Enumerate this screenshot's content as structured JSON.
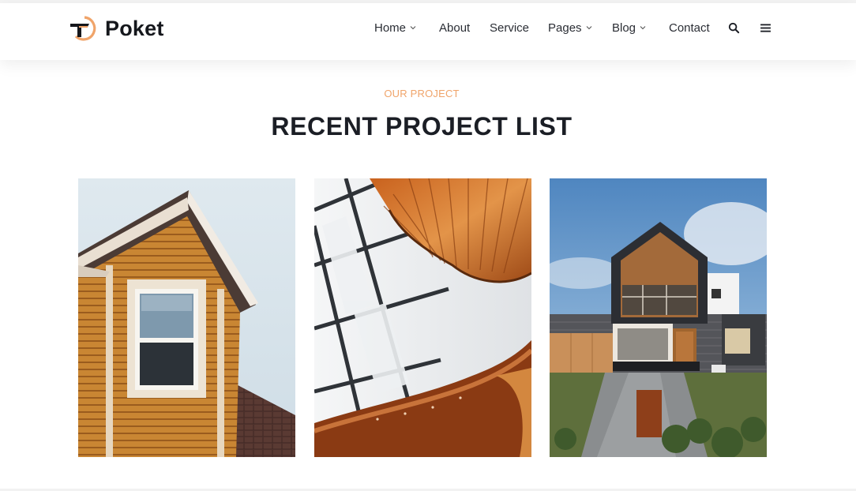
{
  "brand": {
    "name": "Poket",
    "accent": "#f0a46a",
    "dark": "#15171c"
  },
  "nav": {
    "items": [
      {
        "label": "Home",
        "has_dropdown": true
      },
      {
        "label": "About",
        "has_dropdown": false
      },
      {
        "label": "Service",
        "has_dropdown": false
      },
      {
        "label": "Pages",
        "has_dropdown": true
      },
      {
        "label": "Blog",
        "has_dropdown": true
      },
      {
        "label": "Contact",
        "has_dropdown": false
      }
    ],
    "icons": [
      "search-icon",
      "menu-icon"
    ]
  },
  "section": {
    "subtitle": "OUR PROJECT",
    "title": "RECENT PROJECT LIST"
  },
  "projects": [
    {
      "image": "wooden-dormer-house-photo"
    },
    {
      "image": "spiral-wooden-staircase-photo"
    },
    {
      "image": "modern-gabled-house-photo"
    }
  ]
}
